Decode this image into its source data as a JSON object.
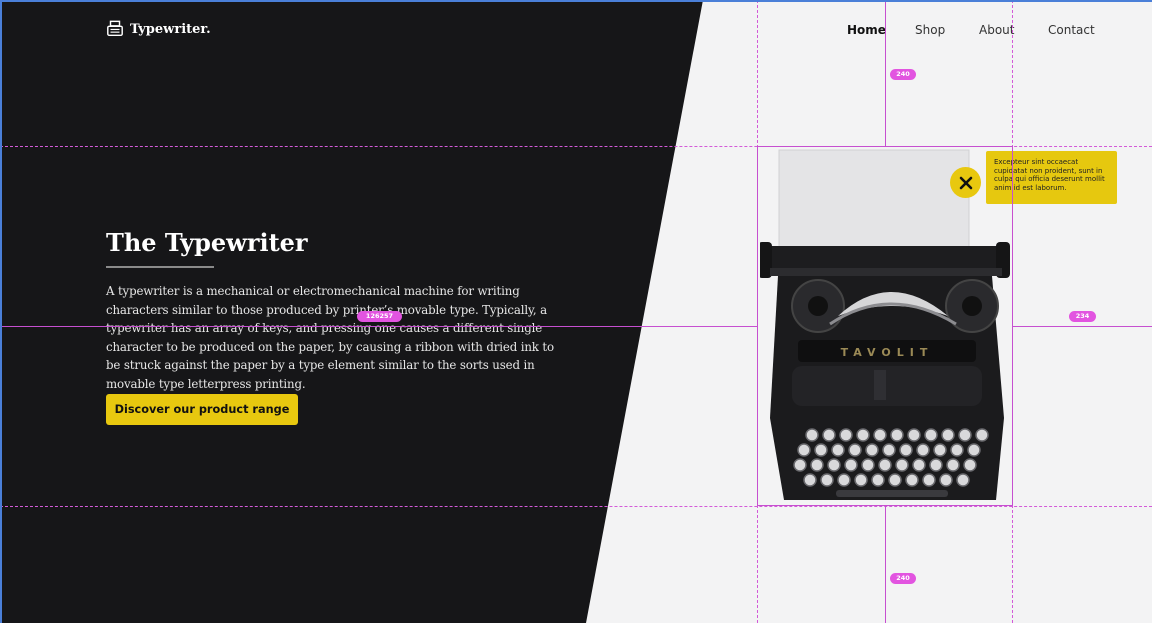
{
  "brand": {
    "name": "Typewriter.",
    "icon": "typewriter-icon"
  },
  "nav": [
    {
      "label": "Home",
      "active": true
    },
    {
      "label": "Shop",
      "active": false
    },
    {
      "label": "About",
      "active": false
    },
    {
      "label": "Contact",
      "active": false
    }
  ],
  "hero": {
    "title": "The Typewriter",
    "description": "A typewriter is a mechanical or electromechanical machine for writing characters similar to those produced by printer’s movable type. Typically, a typewriter has an array of keys, and pressing one causes a different single character to be produced on the paper, by causing a ribbon with dried ink to be struck against the paper by a type element similar to the sorts used in movable type letterpress printing.",
    "cta_label": "Discover our product range"
  },
  "tooltip": {
    "text": "Excepteur sint occaecat cupidatat non proident, sunt in culpa qui officia deserunt mollit anim id est laborum.",
    "close_icon": "close-icon"
  },
  "product_image": {
    "label": "TAVOLIT"
  },
  "measurements": {
    "top": "240",
    "center": "126257",
    "right": "234",
    "bottom": "240"
  },
  "colors": {
    "dark": "#161618",
    "light": "#f3f3f4",
    "accent": "#e8c80f",
    "guide": "#d35ad8"
  }
}
